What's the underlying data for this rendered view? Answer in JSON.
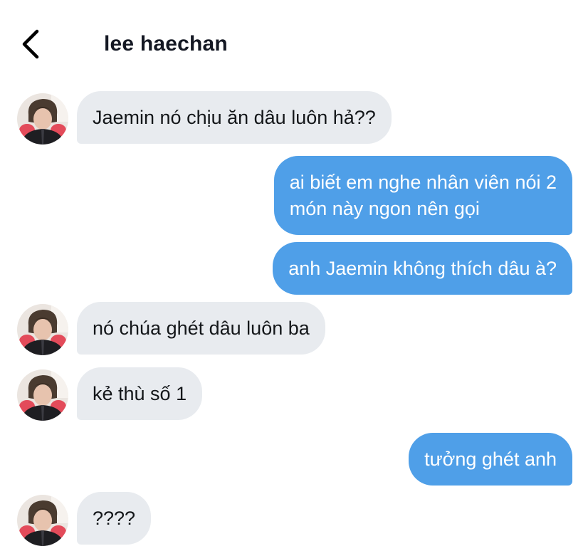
{
  "header": {
    "back_icon": "chevron-left-icon",
    "title": "lee haechan"
  },
  "messages": [
    {
      "sender": "other",
      "text": "Jaemin nó chịu ăn dâu luôn hả??"
    },
    {
      "sender": "me",
      "lines": [
        "ai biết em nghe nhân viên nói 2",
        "món này ngon nên gọi"
      ]
    },
    {
      "sender": "me",
      "text": "anh Jaemin không thích dâu à?"
    },
    {
      "sender": "other",
      "text": "nó chúa ghét dâu luôn ba"
    },
    {
      "sender": "other",
      "text": "kẻ thù số 1"
    },
    {
      "sender": "me",
      "text": "tưởng ghét anh"
    },
    {
      "sender": "other",
      "text": "????"
    }
  ],
  "colors": {
    "incoming_bubble": "#e8ebef",
    "outgoing_bubble": "#4f9fe8",
    "title_text": "#141823"
  }
}
